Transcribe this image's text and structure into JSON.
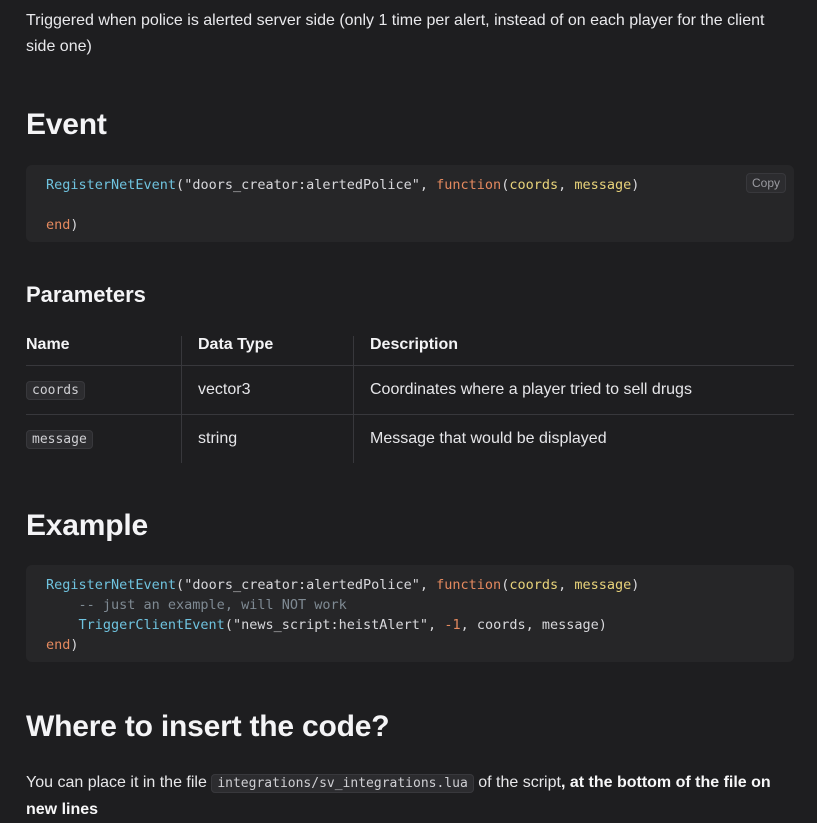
{
  "intro": "Triggered when police is alerted server side (only 1 time per alert, instead of on each player for the client side one)",
  "event_heading": "Event",
  "event_code": {
    "fn": "RegisterNetEvent",
    "event_name": "\"doors_creator:alertedPolice\"",
    "kw_function": "function",
    "p1": "coords",
    "p2": "message",
    "end": "end",
    "copy_label": "Copy"
  },
  "params_heading": "Parameters",
  "table": {
    "headers": [
      "Name",
      "Data Type",
      "Description"
    ],
    "rows": [
      {
        "name": "coords",
        "type": "vector3",
        "desc": "Coordinates where a player tried to sell drugs"
      },
      {
        "name": "message",
        "type": "string",
        "desc": "Message that would be displayed"
      }
    ]
  },
  "example_heading": "Example",
  "example_code": {
    "fn": "RegisterNetEvent",
    "event_name": "\"doors_creator:alertedPolice\"",
    "kw_function": "function",
    "p1": "coords",
    "p2": "message",
    "comment": "-- just an example, will NOT work",
    "trigger_fn": "TriggerClientEvent",
    "trigger_event": "\"news_script:heistAlert\"",
    "num": "-1",
    "args_rest": "coords, message",
    "end": "end"
  },
  "where_heading": "Where to insert the code?",
  "where_text": {
    "before": "You can place it in the file",
    "file": "integrations/sv_integrations.lua",
    "middle": "of the script",
    "bold": ", at the bottom of the file on new lines"
  }
}
